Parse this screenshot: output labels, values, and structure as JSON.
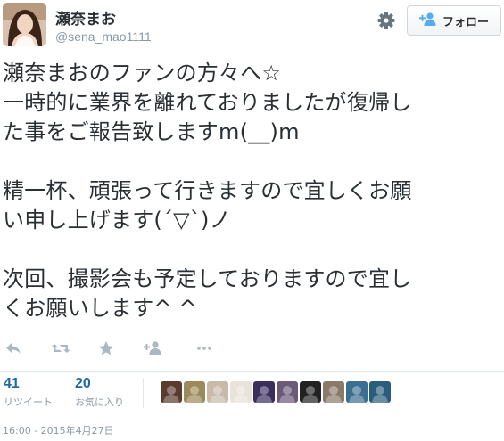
{
  "user": {
    "display_name": "瀬奈まお",
    "screen_name": "@sena_mao1111",
    "avatar_icon": "profile-photo"
  },
  "header": {
    "settings_icon": "gear-icon",
    "follow_label": "フォロー",
    "follow_icon": "person-plus-icon"
  },
  "tweet": {
    "text": "瀬奈まおのファンの方々へ☆\n一時的に業界を離れておりましたが復帰し\nた事をご報告致しますm(__)m\n\n精一杯、頑張って行きますので宜しくお願\nい申し上げます(´▽`)ノ\n\n次回、撮影会も予定しておりますので宜し\nくお願いします^ ^"
  },
  "actions": {
    "icons": [
      "reply-icon",
      "retweet-icon",
      "favorite-icon",
      "follow-icon",
      "more-icon"
    ]
  },
  "stats": {
    "retweets": {
      "count": "41",
      "label": "リツイート"
    },
    "favorites": {
      "count": "20",
      "label": "お気に入り"
    }
  },
  "favoriters": {
    "count": 10,
    "colors": [
      "#5a3b2e",
      "#9c8a5a",
      "#c9b9a8",
      "#e8e2d8",
      "#3a2e5c",
      "#6b5a7a",
      "#222222",
      "#8a7a6a",
      "#3c6e8f",
      "#2a5d7c"
    ]
  },
  "meta": {
    "timestamp": "16:00 - 2015年4月27日"
  },
  "colors": {
    "text": "#292f33",
    "muted": "#8899a6",
    "link": "#1b6ba3",
    "divider": "#e1e8ed"
  }
}
